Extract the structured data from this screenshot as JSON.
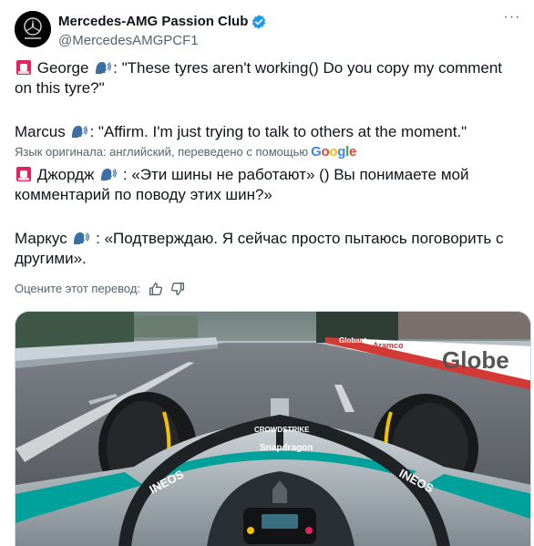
{
  "author": {
    "display_name": "Mercedes-AMG Passion Club",
    "handle": "@MercedesAMGPCF1"
  },
  "tweet": {
    "original": {
      "line1_prefix": " George ",
      "line1_text": ": \"These tyres aren't working() Do you copy my comment on this tyre?\"",
      "line2_prefix": "Marcus ",
      "line2_text": ": \"Affirm. I'm just trying to talk to others at the moment.\""
    },
    "translation_note": "Язык оригинала: английский, переведено с помощью",
    "translation_provider": "Google",
    "translated": {
      "line1_prefix": " Джордж ",
      "line1_text": " : «Эти шины не работают» () Вы понимаете мой комментарий по поводу этих шин?»",
      "line2_prefix": "Маркус ",
      "line2_text": " : «Подтверждаю. Я сейчас просто пытаюсь поговорить с другими»."
    },
    "rate_translation_label": "Оцените этот перевод:"
  },
  "media": {
    "sponsor_halo": "CROWDSTRIKE",
    "sponsor_main": "Snapdragon",
    "sponsor_side": "INEOS",
    "billboard": "Globe",
    "sign1": "Globant",
    "sign2": "Aramco"
  },
  "colors": {
    "text": "#0f1419",
    "secondary": "#536471",
    "verified": "#1d9bf0",
    "petronas": "#00a19b",
    "siren": "#e0245e"
  }
}
